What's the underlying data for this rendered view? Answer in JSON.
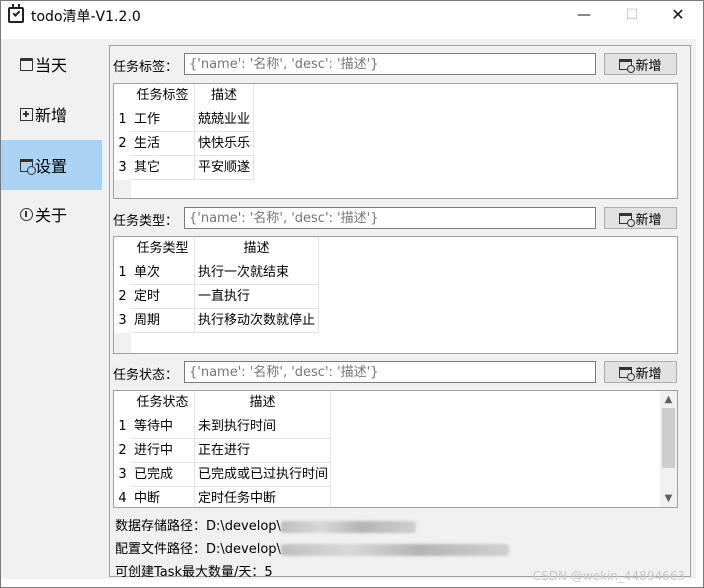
{
  "window": {
    "title": "todo清单-V1.2.0",
    "minimize_glyph": "—",
    "maximize_glyph": "☐",
    "close_glyph": "✕"
  },
  "sidebar": {
    "items": [
      {
        "label": "当天",
        "icon": "calendar-icon",
        "active": false
      },
      {
        "label": "新增",
        "icon": "plus-box-icon",
        "active": false
      },
      {
        "label": "设置",
        "icon": "settings-icon",
        "active": true
      },
      {
        "label": "关于",
        "icon": "info-icon",
        "active": false
      }
    ],
    "active_color": "#a9d2f3"
  },
  "sections": {
    "tags": {
      "label": "任务标签：",
      "placeholder": "{'name': '名称', 'desc': '描述'}",
      "button": "新增",
      "columns": [
        "任务标签",
        "描述"
      ],
      "rows": [
        {
          "n": "1",
          "name": "工作",
          "desc": "兢兢业业"
        },
        {
          "n": "2",
          "name": "生活",
          "desc": "快快乐乐"
        },
        {
          "n": "3",
          "name": "其它",
          "desc": "平安顺遂"
        }
      ]
    },
    "types": {
      "label": "任务类型：",
      "placeholder": "{'name': '名称', 'desc': '描述'}",
      "button": "新增",
      "columns": [
        "任务类型",
        "描述"
      ],
      "rows": [
        {
          "n": "1",
          "name": "单次",
          "desc": "执行一次就结束"
        },
        {
          "n": "2",
          "name": "定时",
          "desc": "一直执行"
        },
        {
          "n": "3",
          "name": "周期",
          "desc": "执行移动次数就停止"
        }
      ]
    },
    "status": {
      "label": "任务状态：",
      "placeholder": "{'name': '名称', 'desc': '描述'}",
      "button": "新增",
      "columns": [
        "任务状态",
        "描述"
      ],
      "rows": [
        {
          "n": "1",
          "name": "等待中",
          "desc": "未到执行时间"
        },
        {
          "n": "2",
          "name": "进行中",
          "desc": "正在进行"
        },
        {
          "n": "3",
          "name": "已完成",
          "desc": "已完成或已过执行时间"
        },
        {
          "n": "4",
          "name": "中断",
          "desc": "定时任务中断"
        }
      ]
    }
  },
  "info": {
    "data_path_label": "数据存储路径：D:\\develop\\",
    "config_path_label": "配置文件路径：D:\\develop\\",
    "max_tasks": "可创建Task最大数量/天：5"
  },
  "watermark": "CSDN @wekin_44894663"
}
